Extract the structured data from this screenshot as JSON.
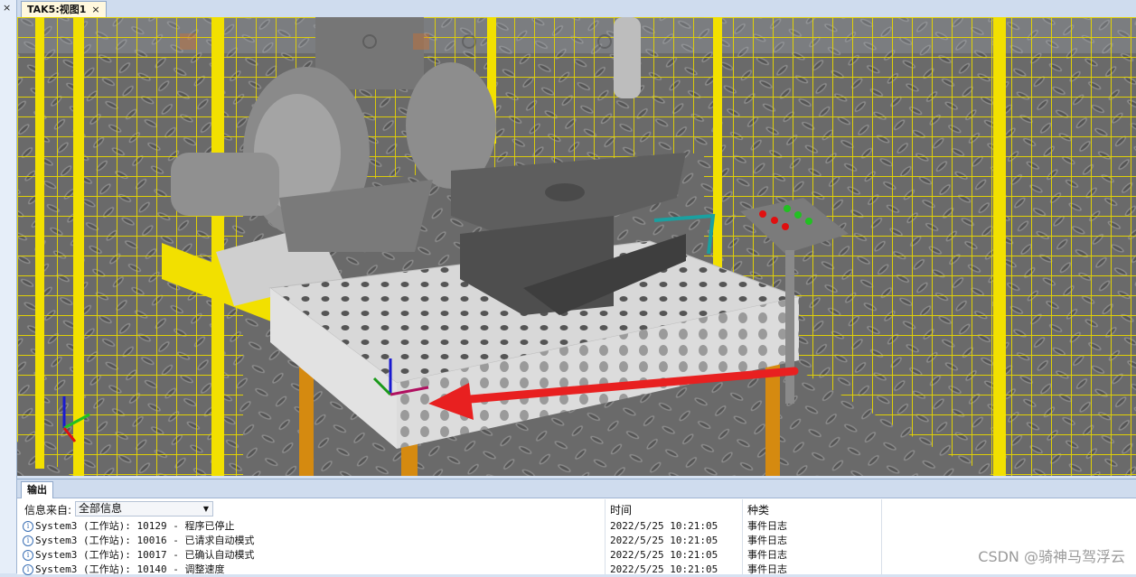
{
  "window": {
    "left_close": "×",
    "doc_tab": {
      "label": "TAK5:视图1",
      "close": "×"
    }
  },
  "viewport": {
    "description_colors": {
      "fence": "#f2e000",
      "floor": "#6c6c6c",
      "table": "#d9d9d9",
      "legs": "#d58a10",
      "arrow": "#e82020"
    }
  },
  "output": {
    "tab_label": "输出",
    "filter": {
      "label": "信息来自:",
      "value": "全部信息"
    },
    "columns": {
      "time": "时间",
      "kind": "种类"
    },
    "rows": [
      {
        "message": "System3 (工作站): 10129 - 程序已停止",
        "time": "2022/5/25 10:21:05",
        "kind": "事件日志"
      },
      {
        "message": "System3 (工作站): 10016 - 已请求自动模式",
        "time": "2022/5/25 10:21:05",
        "kind": "事件日志"
      },
      {
        "message": "System3 (工作站): 10017 - 已确认自动模式",
        "time": "2022/5/25 10:21:05",
        "kind": "事件日志"
      },
      {
        "message": "System3 (工作站): 10140 - 调整速度",
        "time": "2022/5/25 10:21:05",
        "kind": "事件日志"
      }
    ]
  },
  "watermark": "CSDN @骑神马驾浮云"
}
